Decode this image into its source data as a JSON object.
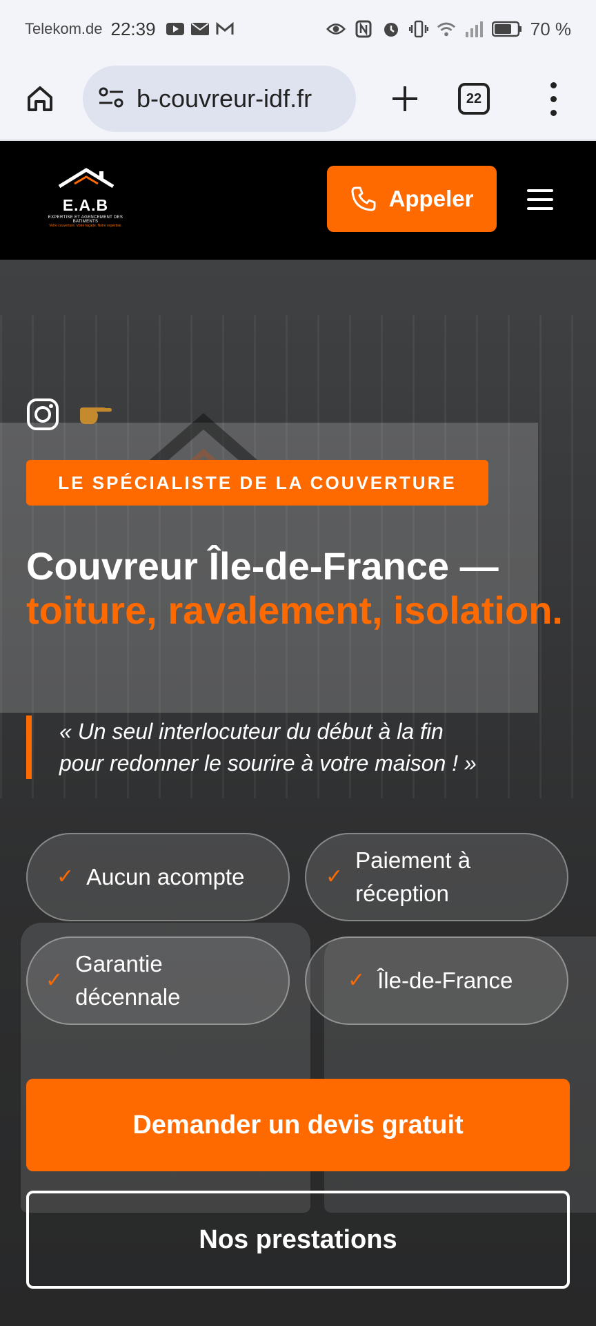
{
  "status_bar": {
    "carrier": "Telekom.de",
    "time": "22:39",
    "battery": "70 %",
    "left_icons": [
      "youtube-icon",
      "mail-icon",
      "gmail-icon"
    ],
    "right_icons": [
      "eye-icon",
      "nfc-icon",
      "alarm-icon",
      "vibrate-icon",
      "wifi-icon",
      "signal-icon",
      "battery-icon"
    ]
  },
  "browser": {
    "url": "b-couvreur-idf.fr",
    "tabs_count": "22"
  },
  "header": {
    "logo_name": "E.A.B",
    "logo_sub": "EXPERTISE ET AGENCEMENT DES BATIMENTS",
    "logo_tagline": "Votre couverture. Votre façade. Notre expertise.",
    "call_label": "Appeler"
  },
  "hero": {
    "badge": "LE SPÉCIALISTE DE LA COUVERTURE",
    "headline_white": "Couvreur Île-de-France —",
    "headline_orange": "toiture, ravalement, isolation.",
    "quote_line1": "« Un seul interlocuteur du début à la fin",
    "quote_line2": "pour redonner le sourire à votre maison ! »",
    "features": [
      {
        "label": "Aucun acompte"
      },
      {
        "label_line1": "Paiement à",
        "label_line2": "réception"
      },
      {
        "label_line1": "Garantie",
        "label_line2": "décennale"
      },
      {
        "label": "Île-de-France"
      }
    ],
    "cta_primary": "Demander un devis gratuit",
    "cta_secondary": "Nos prestations"
  },
  "colors": {
    "accent": "#ff6a00",
    "header_bg": "#000000",
    "browser_bg": "#f3f4fa",
    "url_pill": "#dfe3ef"
  }
}
